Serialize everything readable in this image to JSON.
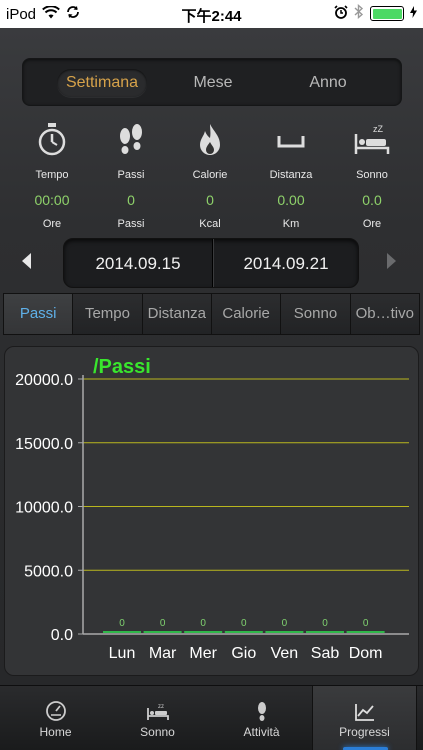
{
  "status_bar": {
    "carrier": "iPod",
    "time": "下午2:44"
  },
  "period_tabs": [
    {
      "label": "Settimana",
      "active": true
    },
    {
      "label": "Mese",
      "active": false
    },
    {
      "label": "Anno",
      "active": false
    }
  ],
  "stats": [
    {
      "icon": "stopwatch-icon",
      "label": "Tempo",
      "value": "00:00",
      "unit": "Ore"
    },
    {
      "icon": "footprints-icon",
      "label": "Passi",
      "value": "0",
      "unit": "Passi"
    },
    {
      "icon": "flame-icon",
      "label": "Calorie",
      "value": "0",
      "unit": "Kcal"
    },
    {
      "icon": "ruler-icon",
      "label": "Distanza",
      "value": "0.00",
      "unit": "Km"
    },
    {
      "icon": "sleep-bed-icon",
      "label": "Sonno",
      "value": "0.0",
      "unit": "Ore"
    }
  ],
  "date_range": {
    "start": "2014.09.15",
    "end": "2014.09.21"
  },
  "metric_tabs": [
    {
      "label": "Passi",
      "active": true
    },
    {
      "label": "Tempo",
      "active": false
    },
    {
      "label": "Distanza",
      "active": false
    },
    {
      "label": "Calorie",
      "active": false
    },
    {
      "label": "Sonno",
      "active": false
    },
    {
      "label": "Ob…tivo",
      "active": false
    }
  ],
  "chart_data": {
    "type": "bar",
    "title": "/Passi",
    "categories": [
      "Lun",
      "Mar",
      "Mer",
      "Gio",
      "Ven",
      "Sab",
      "Dom"
    ],
    "values": [
      0,
      0,
      0,
      0,
      0,
      0,
      0
    ],
    "data_labels": [
      "0",
      "0",
      "0",
      "0",
      "0",
      "0",
      "0"
    ],
    "y_ticks": [
      "0.0",
      "5000.0",
      "10000.0",
      "15000.0",
      "20000.0"
    ],
    "ylim": [
      0,
      20000
    ],
    "grid": true,
    "colors": {
      "title": "#39e62d",
      "grid": "#b9b61e",
      "bar": "#2fb84a",
      "data_label": "#7fd16f"
    }
  },
  "bottom_tabs": [
    {
      "label": "Home",
      "icon": "gauge-icon",
      "active": false
    },
    {
      "label": "Sonno",
      "icon": "bed-icon",
      "active": false
    },
    {
      "label": "Attività",
      "icon": "footprint-icon",
      "active": false
    },
    {
      "label": "Progressi",
      "icon": "chart-line-icon",
      "active": true
    }
  ],
  "colors": {
    "accent_gold": "#d6a24a",
    "value_green": "#8ed16a",
    "tab_blue": "#5fb0e8"
  }
}
